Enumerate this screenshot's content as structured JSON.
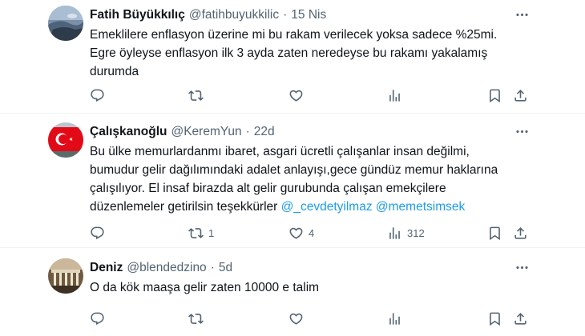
{
  "tweets": [
    {
      "name": "Fatih Büyükkılıç",
      "handle": "@fatihbuyukkilic",
      "separator": "·",
      "time": "15 Nis",
      "lines": [
        "Emeklilere enflasyon üzerine mi bu rakam verilecek yoksa sadece %25mi.",
        "Egre öyleyse enflasyon ilk 3 ayda zaten neredeyse bu rakamı yakalamış",
        "durumda"
      ],
      "replies": "",
      "retweets": "",
      "likes": "",
      "views": ""
    },
    {
      "name": "Çalışkanoğlu",
      "handle": "@KeremYun",
      "separator": "·",
      "time": "22d",
      "lines": [
        "Bu ülke memurlardanmı ibaret, asgari ücretli çalışanlar insan değilmi,",
        "bumudur gelir dağılımındaki adalet anlayışı,gece gündüz memur haklarına",
        "çalışılıyor. El insaf birazda alt gelir gurubunda çalışan emekçilere"
      ],
      "last_line_text": "düzenlemeler getirilsin teşekkürler",
      "mention_1": "@_cevdetyilmaz",
      "mention_2": "@memetsimsek",
      "replies": "",
      "retweets": "1",
      "likes": "4",
      "views": "312"
    },
    {
      "name": "Deniz",
      "handle": "@blendedzino",
      "separator": "·",
      "time": "5d",
      "lines": [
        "O da kök maaşa gelir zaten 10000 e talim"
      ],
      "replies": "",
      "retweets": "",
      "likes": "",
      "views": ""
    }
  ],
  "colors": {
    "text": "#0f1419",
    "secondary": "#536471",
    "link": "#1d9bf0",
    "divider": "#eff3f4"
  },
  "icons": [
    "more-icon",
    "reply-icon",
    "retweet-icon",
    "like-icon",
    "views-icon",
    "bookmark-icon",
    "share-icon"
  ]
}
